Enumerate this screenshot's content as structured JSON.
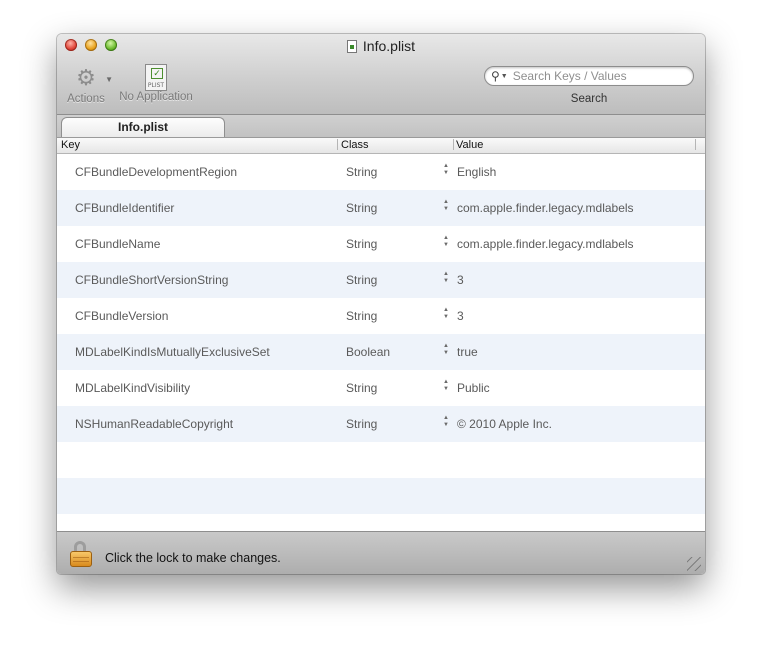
{
  "window": {
    "title": "Info.plist"
  },
  "toolbar": {
    "actions_label": "Actions",
    "no_application_label": "No Application",
    "plist_icon_text": "PLIST",
    "search_placeholder": "Search Keys / Values",
    "search_label": "Search"
  },
  "tabs": [
    {
      "label": "Info.plist",
      "selected": true
    }
  ],
  "table": {
    "columns": [
      "Key",
      "Class",
      "Value"
    ],
    "rows": [
      {
        "key": "CFBundleDevelopmentRegion",
        "class": "String",
        "value": "English"
      },
      {
        "key": "CFBundleIdentifier",
        "class": "String",
        "value": "com.apple.finder.legacy.mdlabels"
      },
      {
        "key": "CFBundleName",
        "class": "String",
        "value": "com.apple.finder.legacy.mdlabels"
      },
      {
        "key": "CFBundleShortVersionString",
        "class": "String",
        "value": "3"
      },
      {
        "key": "CFBundleVersion",
        "class": "String",
        "value": "3"
      },
      {
        "key": "MDLabelKindIsMutuallyExclusiveSet",
        "class": "Boolean",
        "value": "true"
      },
      {
        "key": "MDLabelKindVisibility",
        "class": "String",
        "value": "Public"
      },
      {
        "key": "NSHumanReadableCopyright",
        "class": "String",
        "value": "© 2010 Apple Inc."
      }
    ]
  },
  "status": {
    "text": "Click the lock to make changes."
  },
  "colors": {
    "row_alt": "#eef3fa",
    "lock": "#e3a23a"
  }
}
